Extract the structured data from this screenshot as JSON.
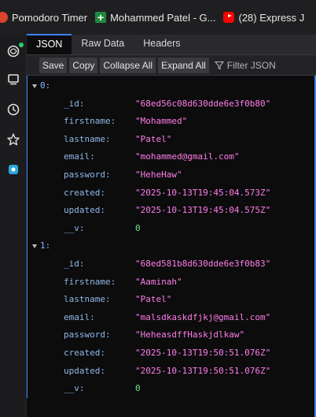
{
  "bookmarks": [
    {
      "label": "Pomodoro Timer",
      "icon": "tomato-icon"
    },
    {
      "label": "Mohammed Patel - G...",
      "icon": "plus-icon"
    },
    {
      "label": "(28) Express J",
      "icon": "youtube-icon"
    }
  ],
  "tabs": [
    "JSON",
    "Raw Data",
    "Headers"
  ],
  "toolbar": {
    "save": "Save",
    "copy": "Copy",
    "collapse": "Collapse All",
    "expand": "Expand All",
    "filter": "Filter JSON"
  },
  "records": [
    {
      "index": "0:",
      "fields": [
        {
          "key": "_id:",
          "value": "\"68ed56c08d630dde6e3f0b80\"",
          "type": "string"
        },
        {
          "key": "firstname:",
          "value": "\"Mohammed\"",
          "type": "string"
        },
        {
          "key": "lastname:",
          "value": "\"Patel\"",
          "type": "string"
        },
        {
          "key": "email:",
          "value": "\"mohammed@gmail.com\"",
          "type": "string"
        },
        {
          "key": "password:",
          "value": "\"HeheHaw\"",
          "type": "string"
        },
        {
          "key": "created:",
          "value": "\"2025-10-13T19:45:04.573Z\"",
          "type": "string"
        },
        {
          "key": "updated:",
          "value": "\"2025-10-13T19:45:04.575Z\"",
          "type": "string"
        },
        {
          "key": "__v:",
          "value": "0",
          "type": "number"
        }
      ]
    },
    {
      "index": "1:",
      "fields": [
        {
          "key": "_id:",
          "value": "\"68ed581b8d630dde6e3f0b83\"",
          "type": "string"
        },
        {
          "key": "firstname:",
          "value": "\"Aaminah\"",
          "type": "string"
        },
        {
          "key": "lastname:",
          "value": "\"Patel\"",
          "type": "string"
        },
        {
          "key": "email:",
          "value": "\"malsdkaskdfjkj@gmail.com\"",
          "type": "string"
        },
        {
          "key": "password:",
          "value": "\"HeheasdffHaskjdlkaw\"",
          "type": "string"
        },
        {
          "key": "created:",
          "value": "\"2025-10-13T19:50:51.076Z\"",
          "type": "string"
        },
        {
          "key": "updated:",
          "value": "\"2025-10-13T19:50:51.076Z\"",
          "type": "string"
        },
        {
          "key": "__v:",
          "value": "0",
          "type": "number"
        }
      ]
    }
  ],
  "sidebar_icons": [
    "chatgpt-icon",
    "notes-icon",
    "history-icon",
    "star-icon",
    "extension-icon"
  ],
  "colors": {
    "accent": "#3b82f6",
    "key": "#8fb8e8",
    "string": "#ff7de9",
    "number": "#6ee787"
  }
}
